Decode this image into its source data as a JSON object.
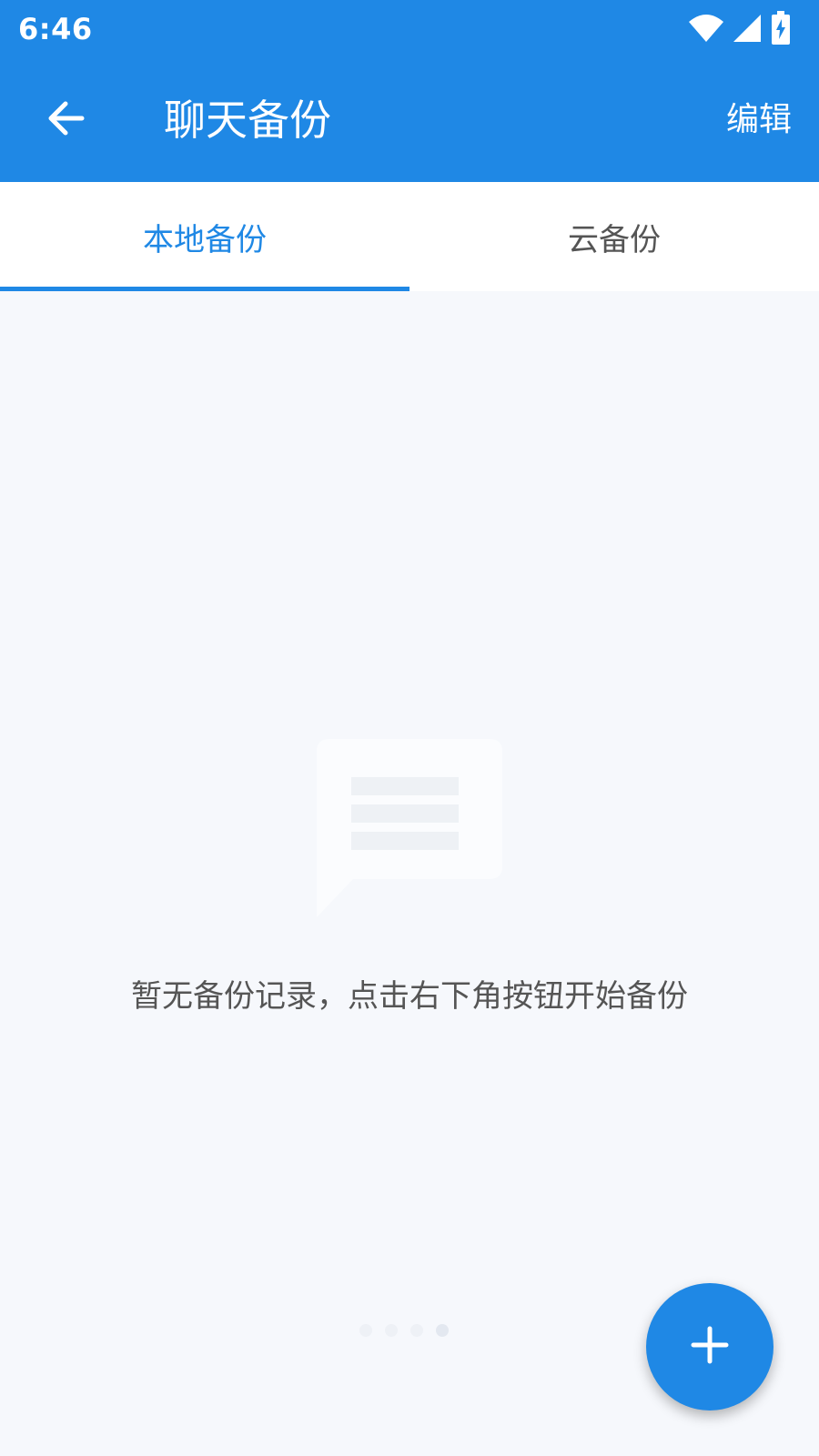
{
  "status_bar": {
    "time": "6:46",
    "icons": [
      "wifi-icon",
      "cellular-signal-icon",
      "battery-charging-icon"
    ]
  },
  "app_bar": {
    "title": "聊天备份",
    "back_icon": "arrow-left-icon",
    "edit_label": "编辑"
  },
  "tabs": [
    {
      "label": "本地备份",
      "active": true
    },
    {
      "label": "云备份",
      "active": false
    }
  ],
  "empty_state": {
    "icon": "chat-message-icon",
    "message": "暂无备份记录，点击右下角按钮开始备份"
  },
  "fab": {
    "icon": "plus-icon"
  },
  "colors": {
    "primary": "#1f88e5",
    "background": "#f6f8fc",
    "text_secondary": "#555555"
  }
}
